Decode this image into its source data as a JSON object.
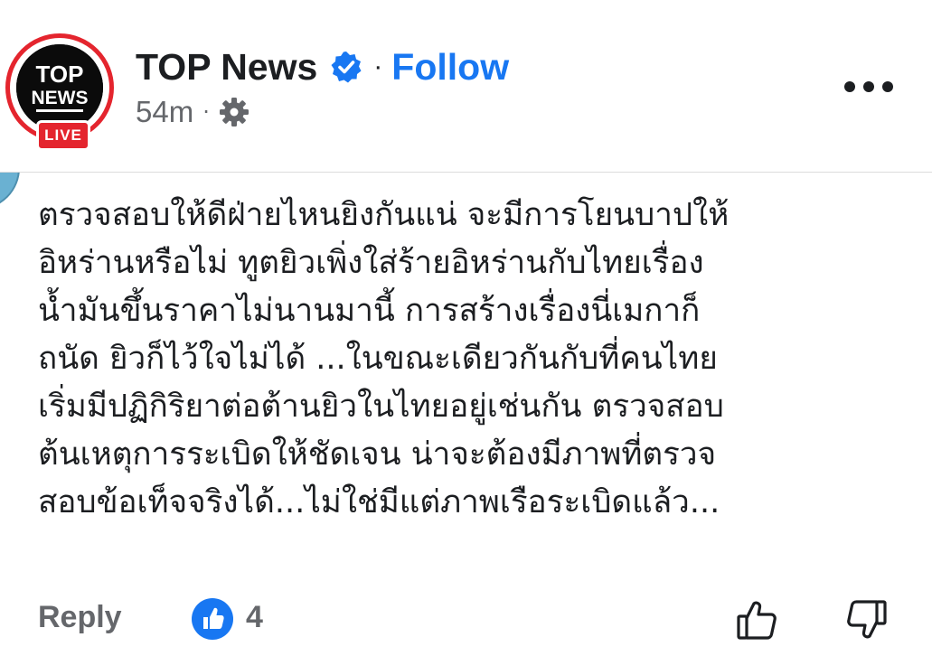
{
  "post_header": {
    "avatar_logo_text_top": "TOP",
    "avatar_logo_text_bottom": "NEWS",
    "live_badge": "LIVE",
    "page_name": "TOP News",
    "separator": "·",
    "follow_label": "Follow",
    "timestamp": "54m",
    "meta_separator": "·",
    "audience_icon": "gear-icon",
    "more_icon": "more-horizontal-icon"
  },
  "comment": {
    "lines": [
      "ตรวจสอบให้ดีฝ่ายไหนยิงกันแน่ จะมีการโยนบาปให้",
      "อิหร่านหรือไม่ ทูตยิวเพิ่งใส่ร้ายอิหร่านกับไทยเรื่อง",
      "น้ำมันขึ้นราคาไม่นานมานี้ การสร้างเรื่องนี่เมกาก็",
      "ถนัด ยิวก็ไว้ใจไม่ได้ ...ในขณะเดียวกันกับที่คนไทย",
      "เริ่มมีปฏิกิริยาต่อต้านยิวในไทยอยู่เช่นกัน ตรวจสอบ",
      "ต้นเหตุการระเบิดให้ชัดเจน น่าจะต้องมีภาพที่ตรวจ",
      "สอบข้อเท็จจริงได้...ไม่ใช่มีแต่ภาพเรือระเบิดแล้ว..."
    ]
  },
  "actions": {
    "reply_label": "Reply",
    "reaction_icon": "like-reaction-icon",
    "reaction_count": "4",
    "thumb_up_icon": "thumbs-up-icon",
    "thumb_down_icon": "thumbs-down-icon"
  },
  "colors": {
    "brand_blue": "#1877f2",
    "live_red": "#e4252e",
    "muted_text": "#65676b",
    "primary_text": "#1c1e21"
  }
}
